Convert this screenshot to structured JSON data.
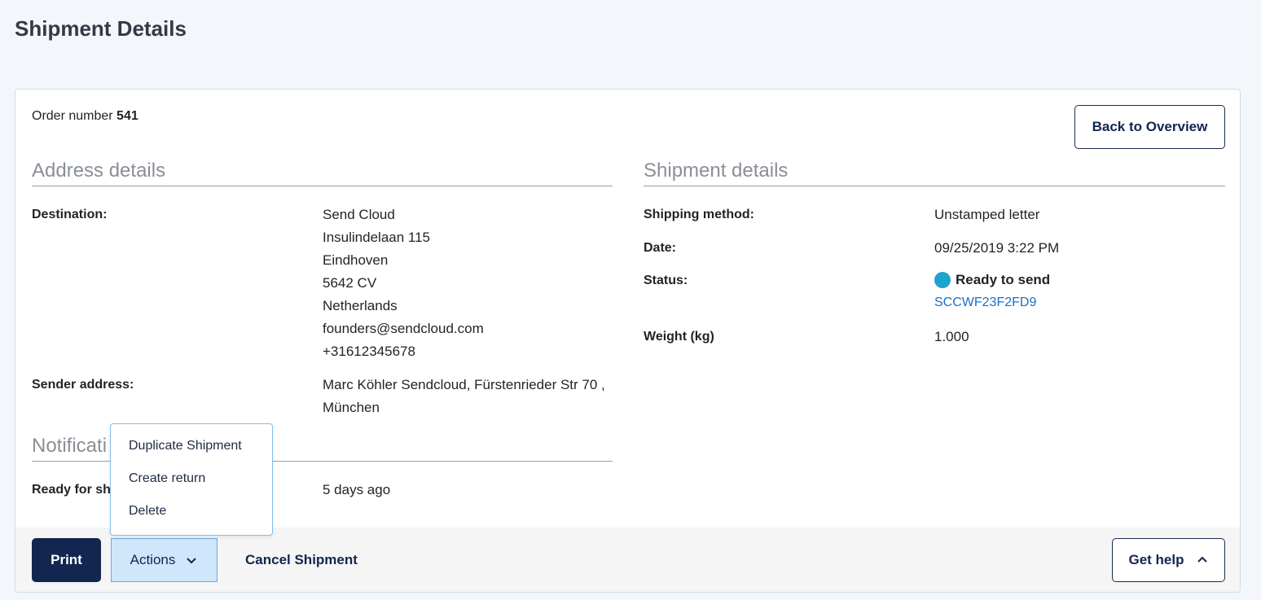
{
  "page": {
    "title": "Shipment Details"
  },
  "order": {
    "label": "Order number",
    "number": "541"
  },
  "buttons": {
    "back": "Back to Overview",
    "print": "Print",
    "actions": "Actions",
    "cancel": "Cancel Shipment",
    "help": "Get help"
  },
  "address": {
    "title": "Address details",
    "destination_label": "Destination:",
    "destination_lines": [
      "Send Cloud",
      "Insulindelaan 115",
      "Eindhoven",
      "5642 CV",
      "Netherlands",
      "founders@sendcloud.com",
      "+31612345678"
    ],
    "sender_label": "Sender address:",
    "sender_lines": [
      "Marc Köhler Sendcloud, Fürstenrieder Str 70 ,",
      "München"
    ]
  },
  "shipment": {
    "title": "Shipment details",
    "method_label": "Shipping method:",
    "method_value": "Unstamped letter",
    "date_label": "Date:",
    "date_value": "09/25/2019 3:22 PM",
    "status_label": "Status:",
    "status_value": "Ready to send",
    "status_color": "#1da3cc",
    "tracking": "SCCWF23F2FD9",
    "weight_label": "Weight (kg)",
    "weight_value": "1.000"
  },
  "notifications": {
    "title": "Notificati",
    "row_label": "Ready for sh",
    "row_value": "5 days ago"
  },
  "actions_menu": {
    "items": [
      "Duplicate Shipment",
      "Create return",
      "Delete"
    ]
  },
  "icons": {
    "actions": "chevron-down-icon",
    "help": "chevron-up-icon"
  },
  "colors": {
    "primary": "#12264f",
    "link": "#1a6fc4",
    "actions_bg": "#cfe6fb"
  }
}
